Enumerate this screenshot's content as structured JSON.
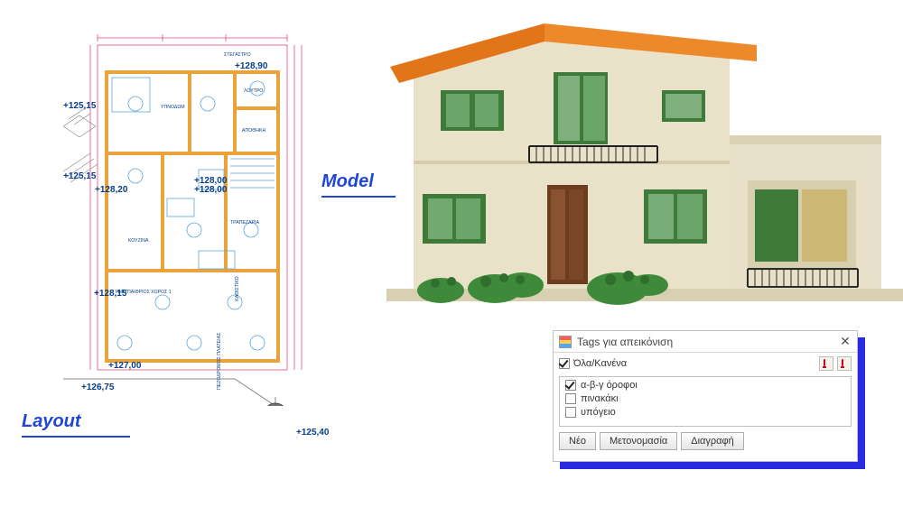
{
  "labels": {
    "layout": "Layout",
    "model": "Model"
  },
  "floorplan": {
    "rooms": {
      "stegastro": "ΣΤΕΓΑΣΤΡΟ",
      "ypnosom": "YΠΝΟΔΩΜ",
      "loutro": "ΛΟΥΤΡΟ",
      "apothiki": "ΑΠΟΘΗΚΗ",
      "trapezaria": "ΤΡΑΠΕΖΑΡΙΑ",
      "kouzina": "ΚΟΥΖΙΝΑ",
      "kathistiko": "ΚΑΘΙΣΤΙΚΟ",
      "hmypaithrios": "ΗΜΙΥΠΑΙΘΡΙΟΣ ΧΩΡΟΣ 1"
    },
    "elevations": {
      "e1": "+125,15",
      "e2": "+125,15",
      "e3": "+128,00",
      "e4": "+128,90",
      "e5": "+128,00",
      "e6": "+128,20",
      "e7": "+128,15",
      "e8": "+127,00",
      "e9": "+126,75",
      "e10": "+125,40"
    },
    "axis_note": "ΠΕΖΟΔΡΟΜΟΣ ΠΛΑΤΕΙΑΣ"
  },
  "dialog": {
    "title": "Tags για απεικόνιση",
    "close": "✕",
    "all_none": "Όλα/Κανένα",
    "tags": [
      {
        "label": "α-β-γ όροφοι",
        "checked": true
      },
      {
        "label": "πινακάκι",
        "checked": false
      },
      {
        "label": "υπόγειο",
        "checked": false
      }
    ],
    "buttons": {
      "new": "Νέο",
      "rename": "Μετονομασία",
      "delete": "Διαγραφή"
    }
  }
}
